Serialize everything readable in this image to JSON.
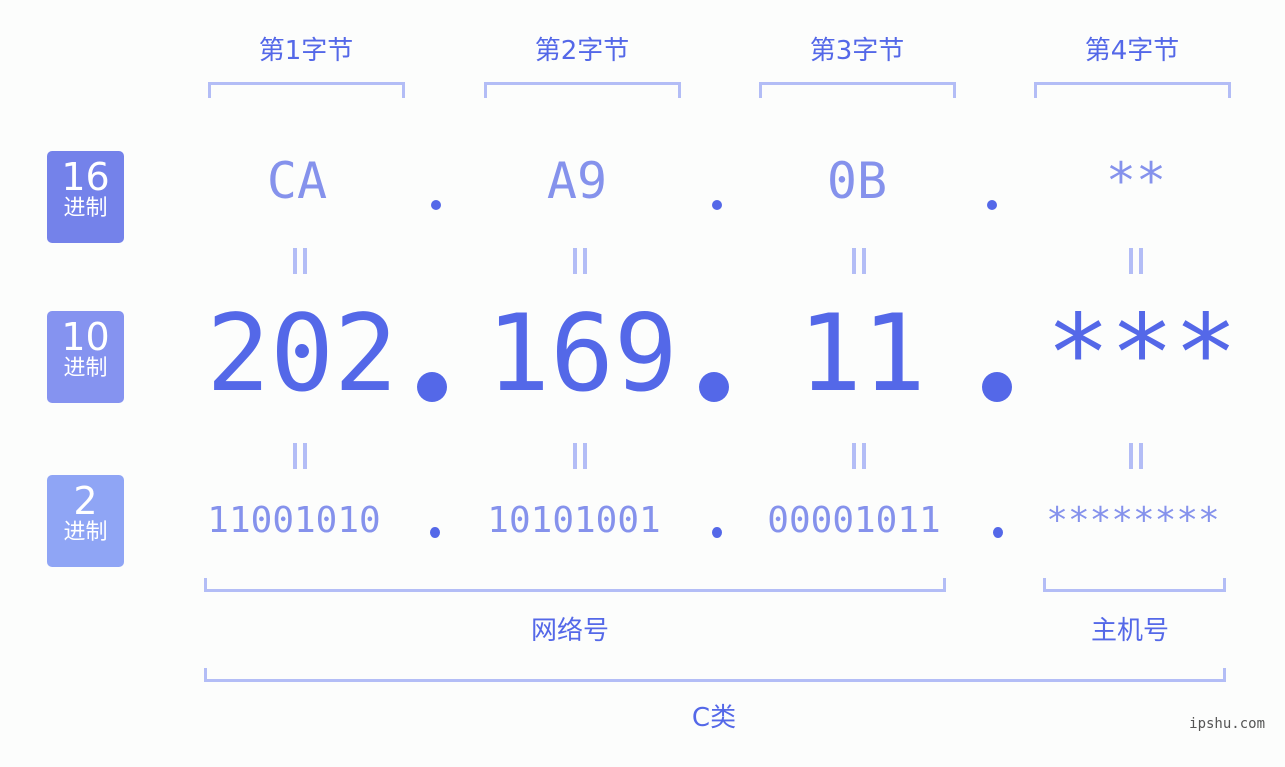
{
  "byte_labels": [
    "第1字节",
    "第2字节",
    "第3字节",
    "第4字节"
  ],
  "badges": {
    "hex": {
      "number": "16",
      "unit": "进制",
      "color": "#7482ea"
    },
    "dec": {
      "number": "10",
      "unit": "进制",
      "color": "#8593f0"
    },
    "bin": {
      "number": "2",
      "unit": "进制",
      "color": "#8fa5f5"
    }
  },
  "hex_values": [
    "CA",
    "A9",
    "0B",
    "**"
  ],
  "dec_values": [
    "202",
    "169",
    "11",
    "***"
  ],
  "bin_values": [
    "11001010",
    "10101001",
    "00001011",
    "********"
  ],
  "separator": ".",
  "equals": "=",
  "network_label": "网络号",
  "host_label": "主机号",
  "class_label": "C类",
  "watermark": "ipshu.com",
  "colors": {
    "primary": "#5468e8",
    "light": "#8592ec",
    "bracket": "#b3bdf6"
  }
}
